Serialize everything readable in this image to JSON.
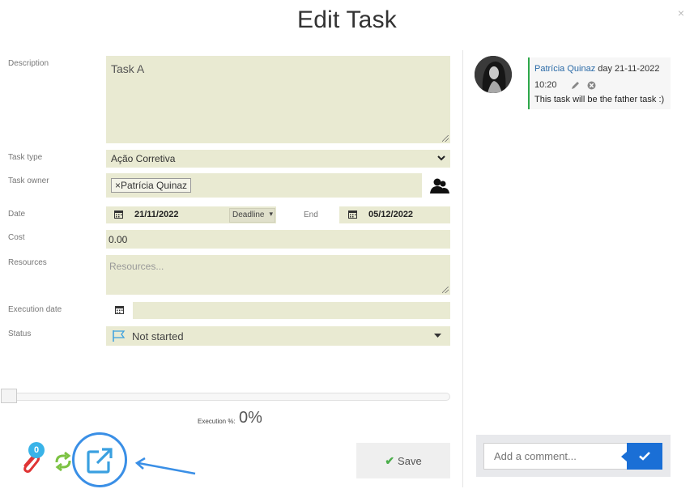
{
  "dialog": {
    "title": "Edit Task",
    "close_label": "×"
  },
  "form": {
    "description": {
      "label": "Description",
      "value": "Task A"
    },
    "task_type": {
      "label": "Task type",
      "value": "Ação Corretiva"
    },
    "task_owner": {
      "label": "Task owner",
      "tag": "×Patrícia Quinaz"
    },
    "date": {
      "label": "Date",
      "start": "21/11/2022",
      "deadline_option": "Deadline",
      "end_label": "End",
      "end": "05/12/2022"
    },
    "cost": {
      "label": "Cost",
      "value": "0.00"
    },
    "resources": {
      "label": "Resources",
      "placeholder": "Resources..."
    },
    "execution_date": {
      "label": "Execution date",
      "value": ""
    },
    "status": {
      "label": "Status",
      "value": "Not started"
    }
  },
  "execution": {
    "label": "Execution %:",
    "value": "0%",
    "percent": 0
  },
  "actions": {
    "save_label": "Save",
    "attachments_count": "0"
  },
  "comments": {
    "items": [
      {
        "author": "Patrícia Quinaz",
        "date_text": " day 21-11-2022",
        "time": "10:20",
        "text": "This task will be the father task :)"
      }
    ],
    "input_placeholder": "Add a comment..."
  },
  "colors": {
    "field_bg": "#e9ead2",
    "accent_blue": "#1a6fd6",
    "highlight": "#3a8fe6",
    "comment_border": "#2ea84a",
    "badge": "#39b3e8"
  },
  "icons": [
    "close-icon",
    "chevron-down-icon",
    "user-group-icon",
    "calendar-icon",
    "flag-icon",
    "caret-down-icon",
    "pencil-icon",
    "remove-icon",
    "checkmark-icon",
    "paperclip-icon",
    "recurrence-icon",
    "external-link-icon",
    "arrow-icon"
  ]
}
